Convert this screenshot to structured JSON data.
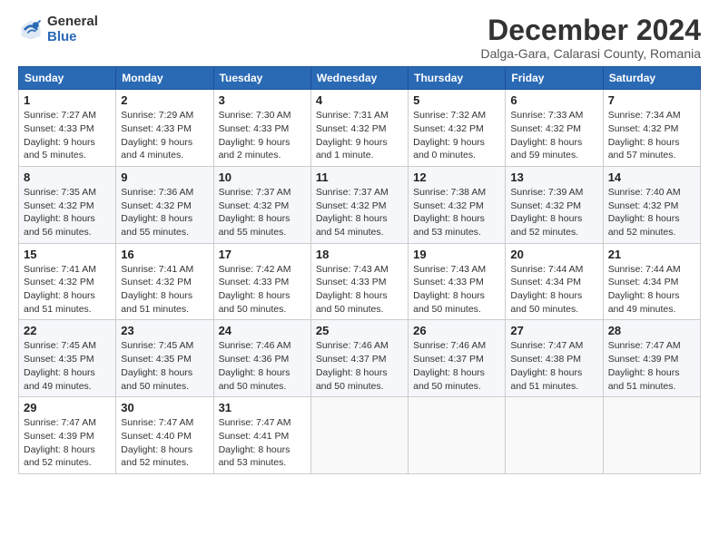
{
  "logo": {
    "general": "General",
    "blue": "Blue"
  },
  "title": "December 2024",
  "subtitle": "Dalga-Gara, Calarasi County, Romania",
  "header": {
    "days": [
      "Sunday",
      "Monday",
      "Tuesday",
      "Wednesday",
      "Thursday",
      "Friday",
      "Saturday"
    ]
  },
  "weeks": [
    [
      {
        "day": "1",
        "sunrise": "7:27 AM",
        "sunset": "4:33 PM",
        "daylight": "9 hours and 5 minutes."
      },
      {
        "day": "2",
        "sunrise": "7:29 AM",
        "sunset": "4:33 PM",
        "daylight": "9 hours and 4 minutes."
      },
      {
        "day": "3",
        "sunrise": "7:30 AM",
        "sunset": "4:33 PM",
        "daylight": "9 hours and 2 minutes."
      },
      {
        "day": "4",
        "sunrise": "7:31 AM",
        "sunset": "4:32 PM",
        "daylight": "9 hours and 1 minute."
      },
      {
        "day": "5",
        "sunrise": "7:32 AM",
        "sunset": "4:32 PM",
        "daylight": "9 hours and 0 minutes."
      },
      {
        "day": "6",
        "sunrise": "7:33 AM",
        "sunset": "4:32 PM",
        "daylight": "8 hours and 59 minutes."
      },
      {
        "day": "7",
        "sunrise": "7:34 AM",
        "sunset": "4:32 PM",
        "daylight": "8 hours and 57 minutes."
      }
    ],
    [
      {
        "day": "8",
        "sunrise": "7:35 AM",
        "sunset": "4:32 PM",
        "daylight": "8 hours and 56 minutes."
      },
      {
        "day": "9",
        "sunrise": "7:36 AM",
        "sunset": "4:32 PM",
        "daylight": "8 hours and 55 minutes."
      },
      {
        "day": "10",
        "sunrise": "7:37 AM",
        "sunset": "4:32 PM",
        "daylight": "8 hours and 55 minutes."
      },
      {
        "day": "11",
        "sunrise": "7:37 AM",
        "sunset": "4:32 PM",
        "daylight": "8 hours and 54 minutes."
      },
      {
        "day": "12",
        "sunrise": "7:38 AM",
        "sunset": "4:32 PM",
        "daylight": "8 hours and 53 minutes."
      },
      {
        "day": "13",
        "sunrise": "7:39 AM",
        "sunset": "4:32 PM",
        "daylight": "8 hours and 52 minutes."
      },
      {
        "day": "14",
        "sunrise": "7:40 AM",
        "sunset": "4:32 PM",
        "daylight": "8 hours and 52 minutes."
      }
    ],
    [
      {
        "day": "15",
        "sunrise": "7:41 AM",
        "sunset": "4:32 PM",
        "daylight": "8 hours and 51 minutes."
      },
      {
        "day": "16",
        "sunrise": "7:41 AM",
        "sunset": "4:32 PM",
        "daylight": "8 hours and 51 minutes."
      },
      {
        "day": "17",
        "sunrise": "7:42 AM",
        "sunset": "4:33 PM",
        "daylight": "8 hours and 50 minutes."
      },
      {
        "day": "18",
        "sunrise": "7:43 AM",
        "sunset": "4:33 PM",
        "daylight": "8 hours and 50 minutes."
      },
      {
        "day": "19",
        "sunrise": "7:43 AM",
        "sunset": "4:33 PM",
        "daylight": "8 hours and 50 minutes."
      },
      {
        "day": "20",
        "sunrise": "7:44 AM",
        "sunset": "4:34 PM",
        "daylight": "8 hours and 50 minutes."
      },
      {
        "day": "21",
        "sunrise": "7:44 AM",
        "sunset": "4:34 PM",
        "daylight": "8 hours and 49 minutes."
      }
    ],
    [
      {
        "day": "22",
        "sunrise": "7:45 AM",
        "sunset": "4:35 PM",
        "daylight": "8 hours and 49 minutes."
      },
      {
        "day": "23",
        "sunrise": "7:45 AM",
        "sunset": "4:35 PM",
        "daylight": "8 hours and 50 minutes."
      },
      {
        "day": "24",
        "sunrise": "7:46 AM",
        "sunset": "4:36 PM",
        "daylight": "8 hours and 50 minutes."
      },
      {
        "day": "25",
        "sunrise": "7:46 AM",
        "sunset": "4:37 PM",
        "daylight": "8 hours and 50 minutes."
      },
      {
        "day": "26",
        "sunrise": "7:46 AM",
        "sunset": "4:37 PM",
        "daylight": "8 hours and 50 minutes."
      },
      {
        "day": "27",
        "sunrise": "7:47 AM",
        "sunset": "4:38 PM",
        "daylight": "8 hours and 51 minutes."
      },
      {
        "day": "28",
        "sunrise": "7:47 AM",
        "sunset": "4:39 PM",
        "daylight": "8 hours and 51 minutes."
      }
    ],
    [
      {
        "day": "29",
        "sunrise": "7:47 AM",
        "sunset": "4:39 PM",
        "daylight": "8 hours and 52 minutes."
      },
      {
        "day": "30",
        "sunrise": "7:47 AM",
        "sunset": "4:40 PM",
        "daylight": "8 hours and 52 minutes."
      },
      {
        "day": "31",
        "sunrise": "7:47 AM",
        "sunset": "4:41 PM",
        "daylight": "8 hours and 53 minutes."
      },
      null,
      null,
      null,
      null
    ]
  ]
}
